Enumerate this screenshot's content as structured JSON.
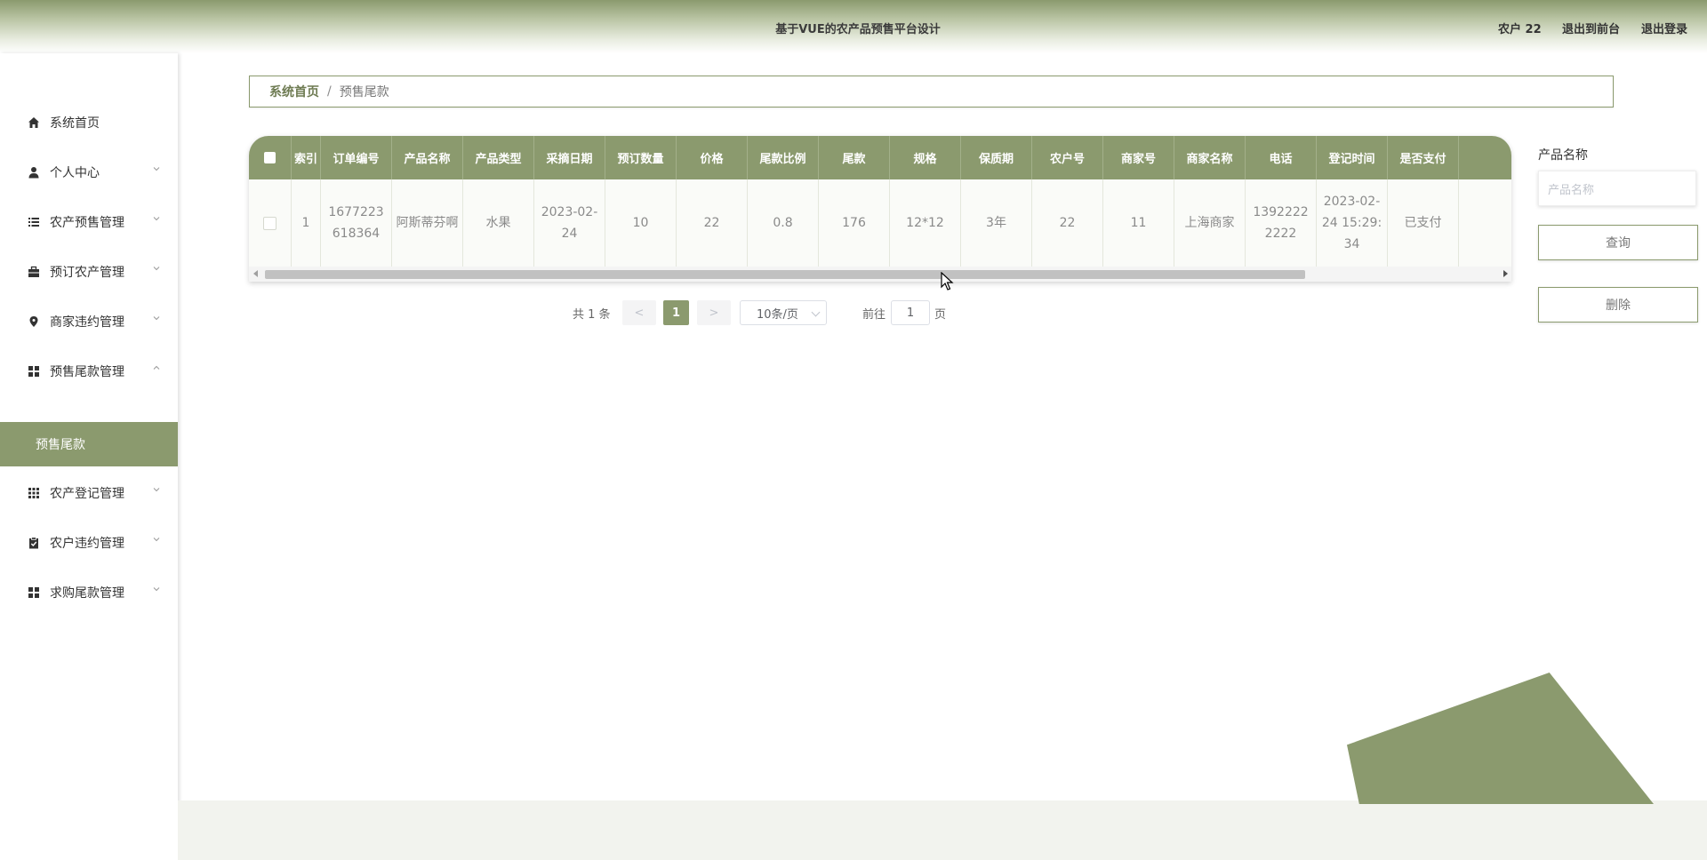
{
  "header": {
    "title": "基于VUE的农产品预售平台设计",
    "user": "农户 22",
    "back_to_front": "退出到前台",
    "logout": "退出登录"
  },
  "sidebar": {
    "items": [
      {
        "label": "系统首页",
        "icon": "home-icon"
      },
      {
        "label": "个人中心",
        "icon": "user-icon"
      },
      {
        "label": "农产预售管理",
        "icon": "list-icon"
      },
      {
        "label": "预订农产管理",
        "icon": "briefcase-icon"
      },
      {
        "label": "商家违约管理",
        "icon": "location-pin-icon"
      },
      {
        "label": "预售尾款管理",
        "icon": "grid-icon"
      },
      {
        "label": "农产登记管理",
        "icon": "apps-icon"
      },
      {
        "label": "农户违约管理",
        "icon": "clipboard-check-icon"
      },
      {
        "label": "求购尾款管理",
        "icon": "grid-icon"
      }
    ],
    "active_submenu": "预售尾款"
  },
  "breadcrumb": {
    "home": "系统首页",
    "separator": "/",
    "current": "预售尾款"
  },
  "table": {
    "columns": [
      "索引",
      "订单编号",
      "产品名称",
      "产品类型",
      "采摘日期",
      "预订数量",
      "价格",
      "尾款比例",
      "尾款",
      "规格",
      "保质期",
      "农户号",
      "商家号",
      "商家名称",
      "电话",
      "登记时间",
      "是否支付"
    ],
    "rows": [
      {
        "index": "1",
        "order_no": "1677223618364",
        "product_name": "阿斯蒂芬啊",
        "product_type": "水果",
        "pick_date": "2023-02-24",
        "quantity": "10",
        "price": "22",
        "balance_ratio": "0.8",
        "balance": "176",
        "spec": "12*12",
        "shelf_life": "3年",
        "farmer_no": "22",
        "merchant_no": "11",
        "merchant_name": "上海商家",
        "phone": "13922222222",
        "register_time": "2023-02-24 15:29:34",
        "paid": "已支付"
      }
    ]
  },
  "pagination": {
    "total_text": "共 1 条",
    "prev": "<",
    "current_page": "1",
    "next": ">",
    "page_size": "10条/页",
    "goto_label": "前往",
    "goto_value": "1",
    "page_suffix": "页"
  },
  "search": {
    "label": "产品名称",
    "placeholder": "产品名称",
    "query_button": "查询",
    "delete_button": "删除"
  },
  "colors": {
    "accent": "#8b9a6e"
  }
}
